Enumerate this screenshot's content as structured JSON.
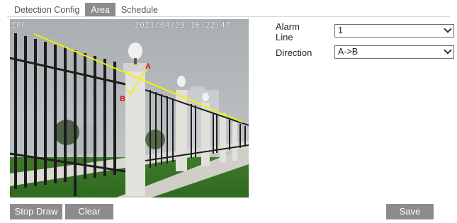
{
  "tabs": [
    {
      "label": "Detection Config",
      "active": false
    },
    {
      "label": "Area",
      "active": true
    },
    {
      "label": "Schedule",
      "active": false
    }
  ],
  "video": {
    "channel_label": "IPC",
    "timestamp": "2021/04/29 16:22:47",
    "marker_a": "A",
    "marker_b": "B",
    "line_color": "#f0f000",
    "marker_color": "#e01010"
  },
  "form": {
    "alarm_line_label": "Alarm Line",
    "alarm_line_value": "1",
    "direction_label": "Direction",
    "direction_value": "A->B"
  },
  "buttons": {
    "stop_draw": "Stop Draw",
    "clear": "Clear",
    "save": "Save"
  },
  "colors": {
    "tab_active_bg": "#8c8c8c",
    "button_bg": "#8c8c8c"
  }
}
